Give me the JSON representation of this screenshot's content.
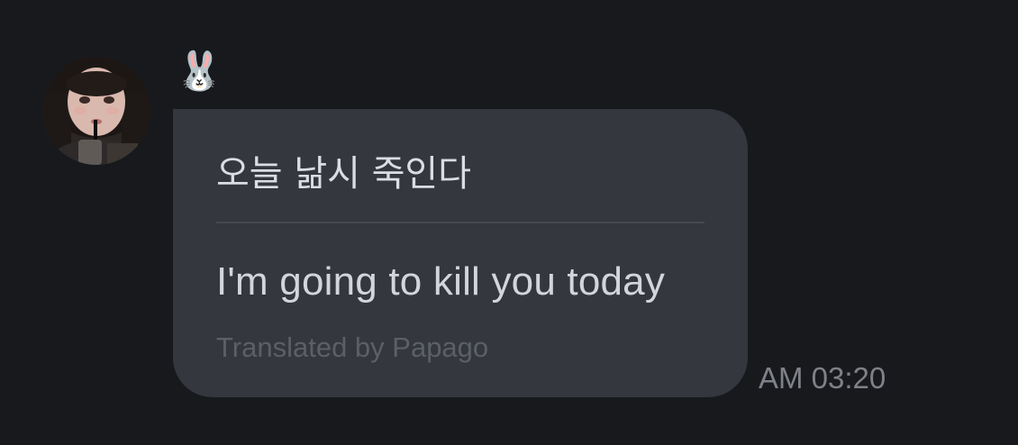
{
  "message": {
    "sender_name": "🐰",
    "avatar_icon": "user-avatar-photo",
    "original_text": "오늘 낢시 죽인다",
    "translated_text": "I'm going to kill you today",
    "translation_credit": "Translated by Papago",
    "timestamp": "AM 03:20"
  },
  "colors": {
    "background": "#18191d",
    "bubble": "#34373e",
    "primary_text": "#dcdde3",
    "muted_text": "#5c5f68",
    "timestamp_text": "#7f8189"
  }
}
